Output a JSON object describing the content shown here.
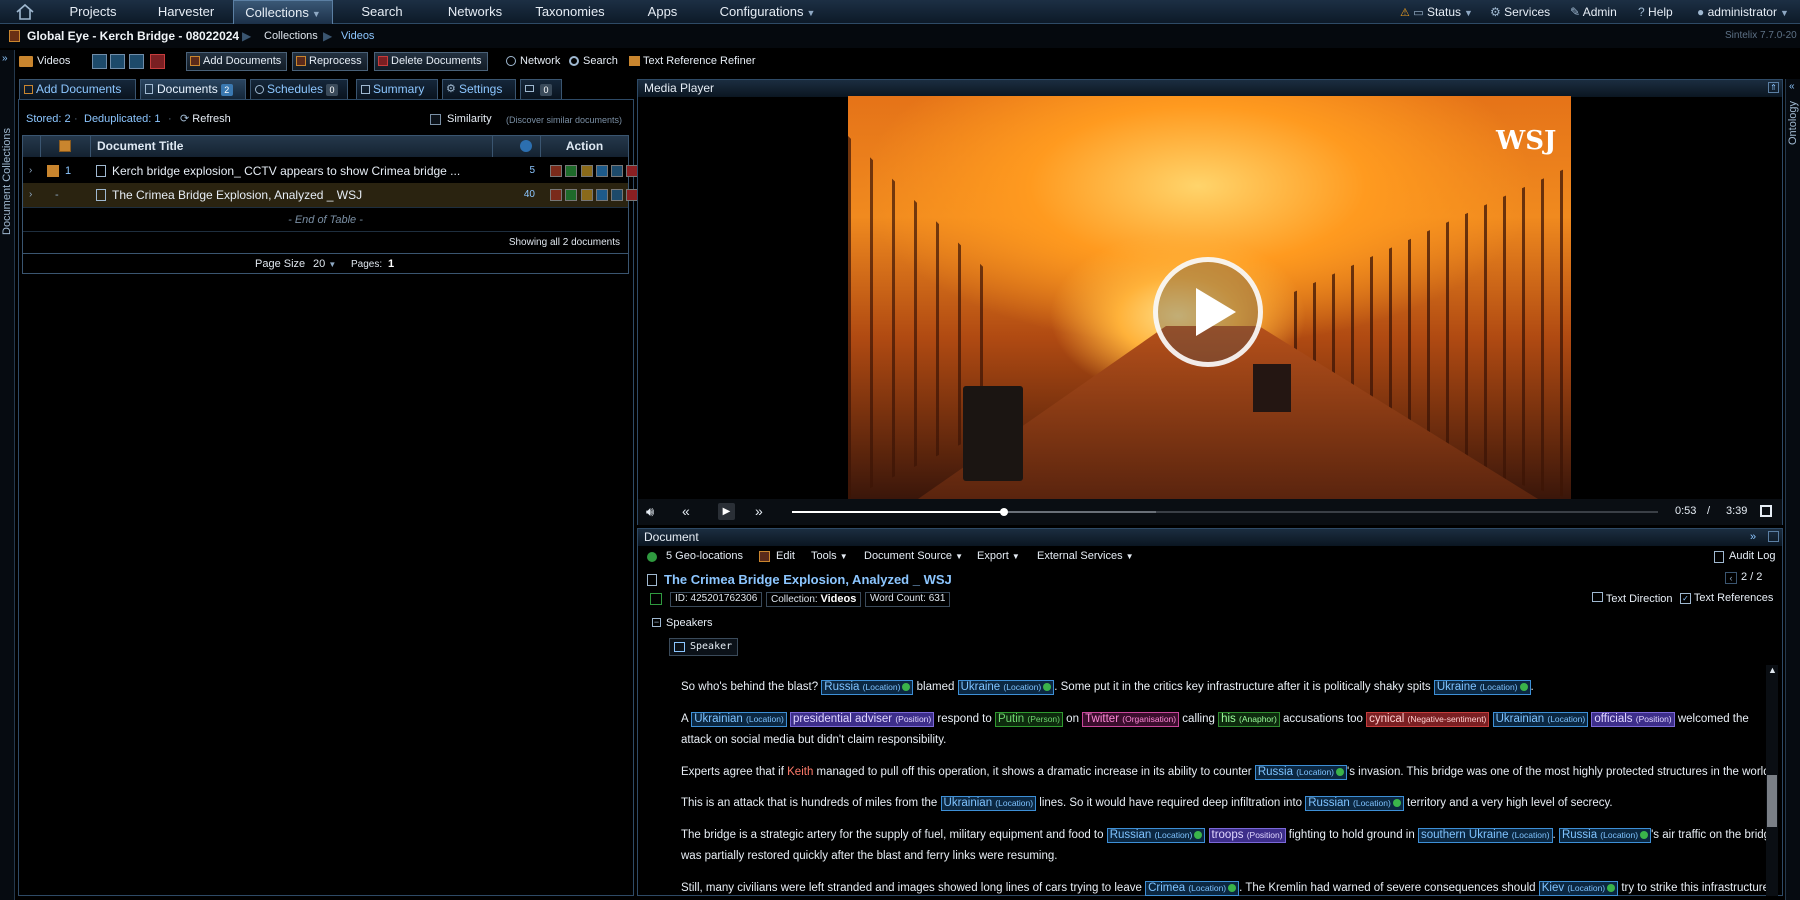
{
  "nav": {
    "items": [
      "Projects",
      "Harvester",
      "Collections",
      "Search",
      "Networks",
      "Taxonomies",
      "Apps",
      "Configurations"
    ],
    "right": {
      "status": "Status",
      "services": "Services",
      "admin": "Admin",
      "help": "Help",
      "user": "administrator"
    }
  },
  "breadcrumb": {
    "project": "Global Eye - Kerch Bridge - 08022024",
    "collections": "Collections",
    "videos": "Videos",
    "version": "Sintelix 7.7.0-20"
  },
  "toolbar": {
    "collection": "Videos",
    "add_documents": "Add Documents",
    "reprocess": "Reprocess",
    "delete_documents": "Delete Documents",
    "network": "Network",
    "search": "Search",
    "text_reference_refiner": "Text Reference Refiner"
  },
  "left_rail": {
    "label": "Document Collections"
  },
  "right_rail": {
    "label": "Ontology"
  },
  "tabs": {
    "add_documents": "Add Documents",
    "documents": "Documents",
    "documents_count": "2",
    "schedules": "Schedules",
    "schedules_count": "0",
    "summary": "Summary",
    "settings": "Settings",
    "extra_count": "0"
  },
  "stats": {
    "stored": "Stored: 2",
    "deduplicated": "Deduplicated: 1",
    "refresh": "Refresh",
    "similarity": "Similarity",
    "similarity_hint": "(Discover similar documents)"
  },
  "table": {
    "headers": {
      "title": "Document Title",
      "action": "Action"
    },
    "rows": [
      {
        "num": "1",
        "title": "Kerch bridge explosion_ CCTV appears to show Crimea bridge ...",
        "count": "5"
      },
      {
        "num": "-",
        "title": "The Crimea Bridge Explosion, Analyzed _ WSJ",
        "count": "40"
      }
    ],
    "end": "- End of Table -",
    "showing": "Showing all 2 documents",
    "page_size_label": "Page Size",
    "page_size": "20",
    "pages_label": "Pages:",
    "pages": "1"
  },
  "media": {
    "title": "Media Player",
    "watermark": "WSJ",
    "current": "0:53",
    "sep": "/",
    "total": "3:39",
    "progress": 0.245,
    "buffered": 0.42
  },
  "document": {
    "panel_title": "Document",
    "geo": "5 Geo-locations",
    "edit": "Edit",
    "tools": "Tools",
    "source": "Document Source",
    "export": "Export",
    "external": "External Services",
    "audit": "Audit Log",
    "title": "The Crimea Bridge Explosion, Analyzed _ WSJ",
    "pager": "2 / 2",
    "id": "ID: 425201762306",
    "collection_label": "Collection:",
    "collection": "Videos",
    "word_count": "Word Count: 631",
    "text_direction": "Text Direction",
    "text_references": "Text References",
    "speakers": "Speakers",
    "speaker": "Speaker"
  },
  "transcript": {
    "p1": [
      "So who's behind the blast? ",
      "Russia",
      " blamed ",
      "Ukraine",
      ". Some put it in the critics key infrastructure after it is politically shaky spits ",
      "Ukraine",
      "."
    ],
    "p2a": [
      "A ",
      "Ukrainian",
      " ",
      "presidential adviser",
      " respond to ",
      "Putin",
      " on ",
      "Twitter",
      " calling ",
      "his",
      " accusations too ",
      "cynical",
      " ",
      "Ukrainian",
      " ",
      "officials",
      " welcomed the"
    ],
    "p2b": "attack on social media but didn't claim responsibility.",
    "p3": [
      "Experts agree that if ",
      "Keith",
      " managed to pull off this operation, it shows a dramatic increase in its ability to counter ",
      "Russia",
      "'s invasion. This bridge was one of the most highly protected structures in the world."
    ],
    "p4": [
      "This is an attack that is hundreds of miles from the ",
      "Ukrainian",
      " lines. So it would have required deep infiltration into ",
      "Russian",
      " territory and a very high level of secrecy."
    ],
    "p5a": [
      "The bridge is a strategic artery for the supply of fuel, military equipment and food to ",
      "Russian",
      " ",
      "troops",
      " fighting to hold ground in ",
      "southern Ukraine",
      ". ",
      "Russia",
      "'s air traffic on the bridge"
    ],
    "p5b": "was partially restored quickly after the blast and ferry links were resuming.",
    "p6": [
      "Still, many civilians were left stranded and images showed long lines of cars trying to leave ",
      "Crimea",
      ". The Kremlin had warned of severe consequences should ",
      "Kiev",
      " try to strike this infrastructure."
    ],
    "labels": {
      "location": "(Location)",
      "position": "(Position)",
      "person": "(Person)",
      "organisation": "(Organisation)",
      "anaphor": "(Anaphor)",
      "negative": "(Negative-sentiment)"
    }
  }
}
